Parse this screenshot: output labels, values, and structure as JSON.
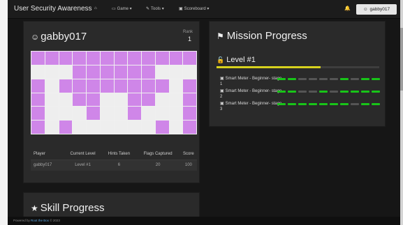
{
  "navbar": {
    "brand": "User Security Awareness",
    "home_icon": "home-icon",
    "items": [
      {
        "label": "Game ▾",
        "icon": "gamepad-icon"
      },
      {
        "label": "Tools ▾",
        "icon": "wrench-icon"
      },
      {
        "label": "Scoreboard ▾",
        "icon": "monitor-icon"
      }
    ],
    "bell_icon": "bell-icon",
    "user": "gabby017"
  },
  "player": {
    "name": "gabby017",
    "rank_label": "Rank",
    "rank": "1",
    "grid": [
      [
        1,
        1,
        1,
        1,
        1,
        1,
        1,
        1,
        1,
        1,
        1,
        1
      ],
      [
        0,
        0,
        0,
        1,
        1,
        1,
        1,
        1,
        1,
        0,
        0,
        0
      ],
      [
        1,
        0,
        1,
        1,
        1,
        1,
        1,
        1,
        1,
        1,
        0,
        1
      ],
      [
        1,
        0,
        0,
        1,
        1,
        0,
        0,
        1,
        1,
        0,
        0,
        1
      ],
      [
        1,
        0,
        0,
        0,
        1,
        0,
        0,
        1,
        0,
        0,
        0,
        1
      ],
      [
        1,
        0,
        1,
        0,
        0,
        0,
        0,
        0,
        0,
        1,
        0,
        1
      ]
    ],
    "table": {
      "headers": [
        "Player",
        "Current Level",
        "Hints Taken",
        "Flags Captured",
        "Score"
      ],
      "row": [
        "gabby017",
        "Level #1",
        "6",
        "20",
        "100"
      ]
    }
  },
  "mission": {
    "title": "Mission Progress",
    "level": "Level #1",
    "progress_fraction": 0.64,
    "stages": [
      {
        "label": "Smart Meter - Beginner- stage 1",
        "segments": [
          1,
          1,
          0,
          0,
          0,
          0,
          1,
          0,
          1,
          1
        ]
      },
      {
        "label": "Smart Meter - Beginner- stage 2",
        "segments": [
          1,
          1,
          0,
          0,
          1,
          0,
          1,
          1,
          1,
          1
        ]
      },
      {
        "label": "Smart Meter - Beginner- stage 3",
        "segments": [
          1,
          1,
          1,
          1,
          1,
          1,
          1,
          0,
          1,
          1
        ]
      }
    ]
  },
  "skill": {
    "title": "Skill Progress"
  },
  "footer": {
    "prefix": "Powered by",
    "link": "Root the Box",
    "suffix": "© 2023"
  },
  "colors": {
    "accent_cell": "#cf86e8",
    "progress": "#d7d21e",
    "segment_on": "#18c418"
  }
}
